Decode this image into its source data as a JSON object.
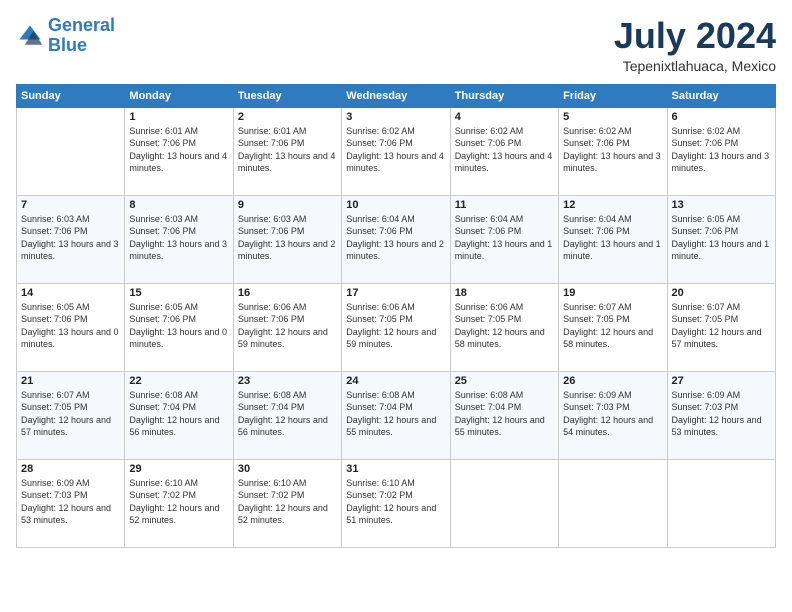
{
  "logo": {
    "line1": "General",
    "line2": "Blue"
  },
  "title": {
    "month_year": "July 2024",
    "location": "Tepenixtlahuaca, Mexico"
  },
  "days_of_week": [
    "Sunday",
    "Monday",
    "Tuesday",
    "Wednesday",
    "Thursday",
    "Friday",
    "Saturday"
  ],
  "weeks": [
    [
      {
        "day": "",
        "sunrise": "",
        "sunset": "",
        "daylight": ""
      },
      {
        "day": "1",
        "sunrise": "Sunrise: 6:01 AM",
        "sunset": "Sunset: 7:06 PM",
        "daylight": "Daylight: 13 hours and 4 minutes."
      },
      {
        "day": "2",
        "sunrise": "Sunrise: 6:01 AM",
        "sunset": "Sunset: 7:06 PM",
        "daylight": "Daylight: 13 hours and 4 minutes."
      },
      {
        "day": "3",
        "sunrise": "Sunrise: 6:02 AM",
        "sunset": "Sunset: 7:06 PM",
        "daylight": "Daylight: 13 hours and 4 minutes."
      },
      {
        "day": "4",
        "sunrise": "Sunrise: 6:02 AM",
        "sunset": "Sunset: 7:06 PM",
        "daylight": "Daylight: 13 hours and 4 minutes."
      },
      {
        "day": "5",
        "sunrise": "Sunrise: 6:02 AM",
        "sunset": "Sunset: 7:06 PM",
        "daylight": "Daylight: 13 hours and 3 minutes."
      },
      {
        "day": "6",
        "sunrise": "Sunrise: 6:02 AM",
        "sunset": "Sunset: 7:06 PM",
        "daylight": "Daylight: 13 hours and 3 minutes."
      }
    ],
    [
      {
        "day": "7",
        "sunrise": "Sunrise: 6:03 AM",
        "sunset": "Sunset: 7:06 PM",
        "daylight": "Daylight: 13 hours and 3 minutes."
      },
      {
        "day": "8",
        "sunrise": "Sunrise: 6:03 AM",
        "sunset": "Sunset: 7:06 PM",
        "daylight": "Daylight: 13 hours and 3 minutes."
      },
      {
        "day": "9",
        "sunrise": "Sunrise: 6:03 AM",
        "sunset": "Sunset: 7:06 PM",
        "daylight": "Daylight: 13 hours and 2 minutes."
      },
      {
        "day": "10",
        "sunrise": "Sunrise: 6:04 AM",
        "sunset": "Sunset: 7:06 PM",
        "daylight": "Daylight: 13 hours and 2 minutes."
      },
      {
        "day": "11",
        "sunrise": "Sunrise: 6:04 AM",
        "sunset": "Sunset: 7:06 PM",
        "daylight": "Daylight: 13 hours and 1 minute."
      },
      {
        "day": "12",
        "sunrise": "Sunrise: 6:04 AM",
        "sunset": "Sunset: 7:06 PM",
        "daylight": "Daylight: 13 hours and 1 minute."
      },
      {
        "day": "13",
        "sunrise": "Sunrise: 6:05 AM",
        "sunset": "Sunset: 7:06 PM",
        "daylight": "Daylight: 13 hours and 1 minute."
      }
    ],
    [
      {
        "day": "14",
        "sunrise": "Sunrise: 6:05 AM",
        "sunset": "Sunset: 7:06 PM",
        "daylight": "Daylight: 13 hours and 0 minutes."
      },
      {
        "day": "15",
        "sunrise": "Sunrise: 6:05 AM",
        "sunset": "Sunset: 7:06 PM",
        "daylight": "Daylight: 13 hours and 0 minutes."
      },
      {
        "day": "16",
        "sunrise": "Sunrise: 6:06 AM",
        "sunset": "Sunset: 7:06 PM",
        "daylight": "Daylight: 12 hours and 59 minutes."
      },
      {
        "day": "17",
        "sunrise": "Sunrise: 6:06 AM",
        "sunset": "Sunset: 7:05 PM",
        "daylight": "Daylight: 12 hours and 59 minutes."
      },
      {
        "day": "18",
        "sunrise": "Sunrise: 6:06 AM",
        "sunset": "Sunset: 7:05 PM",
        "daylight": "Daylight: 12 hours and 58 minutes."
      },
      {
        "day": "19",
        "sunrise": "Sunrise: 6:07 AM",
        "sunset": "Sunset: 7:05 PM",
        "daylight": "Daylight: 12 hours and 58 minutes."
      },
      {
        "day": "20",
        "sunrise": "Sunrise: 6:07 AM",
        "sunset": "Sunset: 7:05 PM",
        "daylight": "Daylight: 12 hours and 57 minutes."
      }
    ],
    [
      {
        "day": "21",
        "sunrise": "Sunrise: 6:07 AM",
        "sunset": "Sunset: 7:05 PM",
        "daylight": "Daylight: 12 hours and 57 minutes."
      },
      {
        "day": "22",
        "sunrise": "Sunrise: 6:08 AM",
        "sunset": "Sunset: 7:04 PM",
        "daylight": "Daylight: 12 hours and 56 minutes."
      },
      {
        "day": "23",
        "sunrise": "Sunrise: 6:08 AM",
        "sunset": "Sunset: 7:04 PM",
        "daylight": "Daylight: 12 hours and 56 minutes."
      },
      {
        "day": "24",
        "sunrise": "Sunrise: 6:08 AM",
        "sunset": "Sunset: 7:04 PM",
        "daylight": "Daylight: 12 hours and 55 minutes."
      },
      {
        "day": "25",
        "sunrise": "Sunrise: 6:08 AM",
        "sunset": "Sunset: 7:04 PM",
        "daylight": "Daylight: 12 hours and 55 minutes."
      },
      {
        "day": "26",
        "sunrise": "Sunrise: 6:09 AM",
        "sunset": "Sunset: 7:03 PM",
        "daylight": "Daylight: 12 hours and 54 minutes."
      },
      {
        "day": "27",
        "sunrise": "Sunrise: 6:09 AM",
        "sunset": "Sunset: 7:03 PM",
        "daylight": "Daylight: 12 hours and 53 minutes."
      }
    ],
    [
      {
        "day": "28",
        "sunrise": "Sunrise: 6:09 AM",
        "sunset": "Sunset: 7:03 PM",
        "daylight": "Daylight: 12 hours and 53 minutes."
      },
      {
        "day": "29",
        "sunrise": "Sunrise: 6:10 AM",
        "sunset": "Sunset: 7:02 PM",
        "daylight": "Daylight: 12 hours and 52 minutes."
      },
      {
        "day": "30",
        "sunrise": "Sunrise: 6:10 AM",
        "sunset": "Sunset: 7:02 PM",
        "daylight": "Daylight: 12 hours and 52 minutes."
      },
      {
        "day": "31",
        "sunrise": "Sunrise: 6:10 AM",
        "sunset": "Sunset: 7:02 PM",
        "daylight": "Daylight: 12 hours and 51 minutes."
      },
      {
        "day": "",
        "sunrise": "",
        "sunset": "",
        "daylight": ""
      },
      {
        "day": "",
        "sunrise": "",
        "sunset": "",
        "daylight": ""
      },
      {
        "day": "",
        "sunrise": "",
        "sunset": "",
        "daylight": ""
      }
    ]
  ]
}
